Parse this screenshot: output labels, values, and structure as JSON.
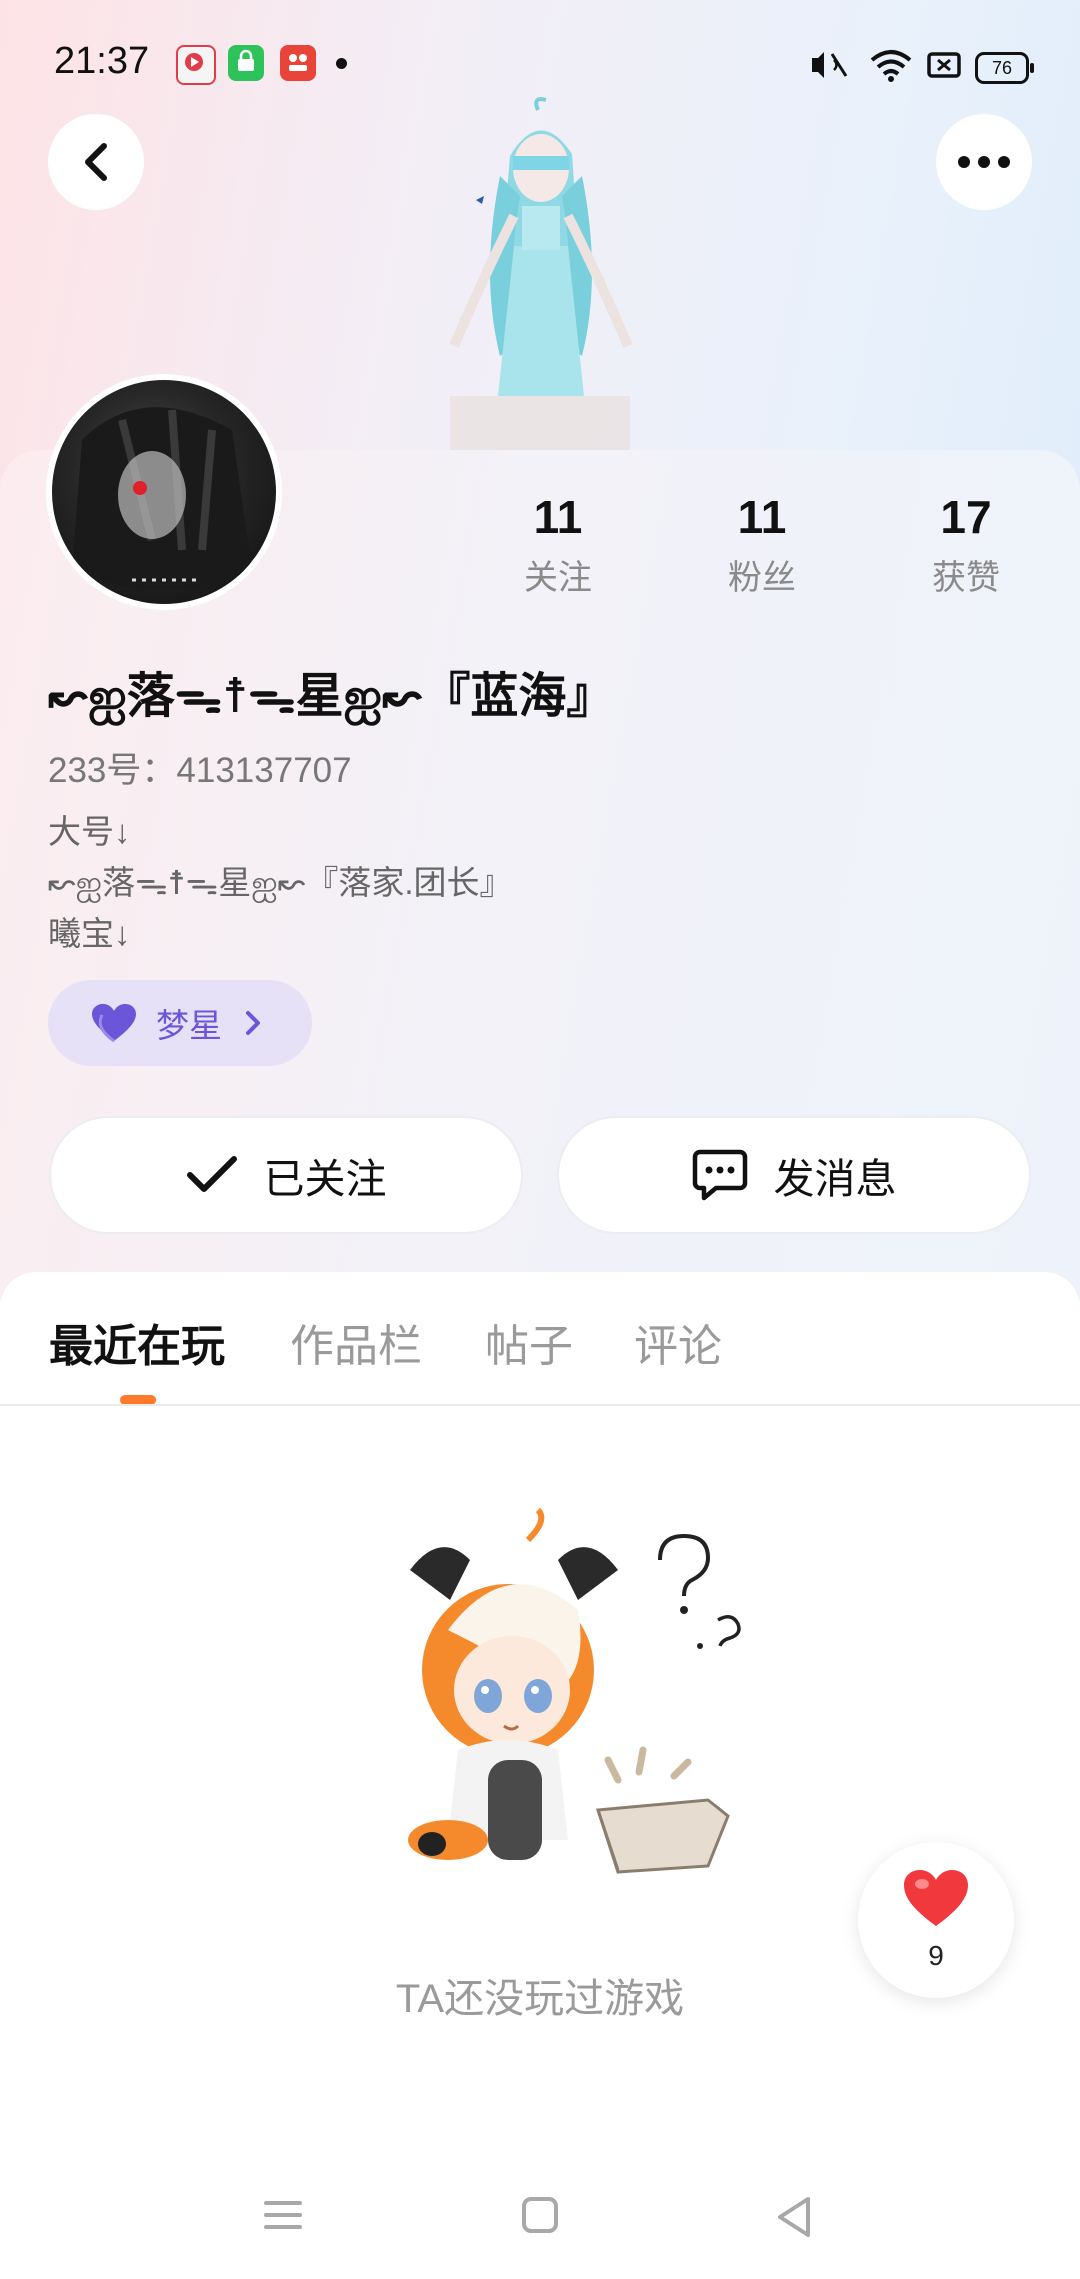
{
  "status_bar": {
    "time": "21:37",
    "battery": "76",
    "icons": [
      "video-app-icon",
      "shopping-app-icon",
      "store-app-icon",
      "notification-dot",
      "mute-icon",
      "wifi-icon",
      "sim-icon",
      "battery-icon"
    ]
  },
  "header": {
    "back_icon": "chevron-left-icon",
    "more_icon": "more-dots-icon"
  },
  "profile": {
    "stats": [
      {
        "value": "11",
        "label": "关注"
      },
      {
        "value": "11",
        "label": "粉丝"
      },
      {
        "value": "17",
        "label": "获赞"
      }
    ],
    "username": "↜ஐ落ᯓ☨ᯓ星ஐ↜『蓝海』",
    "account_id": "233号：413137707",
    "bio": "大号↓\n↜ஐ落ᯓ☨ᯓ星ஐ↜『落家.团长』\n曦宝↓",
    "badge": {
      "label": "梦星",
      "icon": "heart-icon"
    },
    "follow_button": "已关注",
    "message_button": "发消息"
  },
  "tabs": [
    {
      "label": "最近在玩",
      "active": true
    },
    {
      "label": "作品栏",
      "active": false
    },
    {
      "label": "帖子",
      "active": false
    },
    {
      "label": "评论",
      "active": false
    }
  ],
  "empty_state": {
    "message": "TA还没玩过游戏"
  },
  "like_float": {
    "count": "9"
  },
  "colors": {
    "accent_orange": "#ff7a2a",
    "badge_purple": "#6b55d8",
    "like_red": "#f0383d"
  }
}
